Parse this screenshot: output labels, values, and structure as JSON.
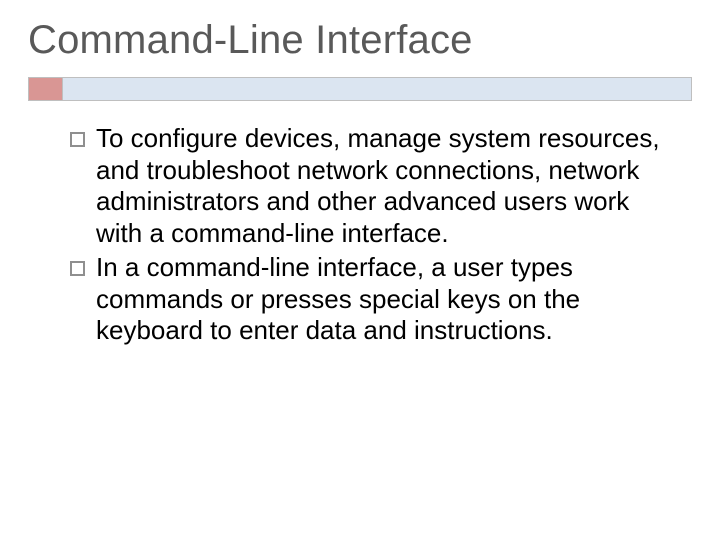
{
  "title": "Command-Line Interface",
  "bullets": [
    "To configure devices, manage system resources, and troubleshoot network connections, network administrators and other advanced users work with a command-line interface.",
    "In a command-line interface, a user types commands or presses special keys on the keyboard to enter data and instructions."
  ]
}
